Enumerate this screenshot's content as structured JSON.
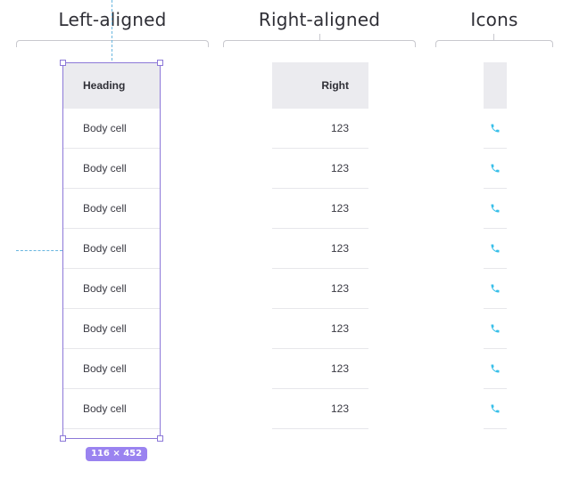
{
  "sections": {
    "left_title": "Left-aligned",
    "right_title": "Right-aligned",
    "icons_title": "Icons"
  },
  "left_table": {
    "heading": "Heading",
    "rows": [
      "Body cell",
      "Body cell",
      "Body cell",
      "Body cell",
      "Body cell",
      "Body cell",
      "Body cell",
      "Body cell"
    ]
  },
  "right_table": {
    "heading": "Right",
    "rows": [
      "123",
      "123",
      "123",
      "123",
      "123",
      "123",
      "123",
      "123"
    ]
  },
  "icons_table": {
    "heading": "",
    "icon_name": "phone-icon",
    "icon_color": "#38bfe9",
    "rows": [
      "phone-icon",
      "phone-icon",
      "phone-icon",
      "phone-icon",
      "phone-icon",
      "phone-icon",
      "phone-icon",
      "phone-icon"
    ]
  },
  "selection": {
    "badge": "116 × 452",
    "accent_color": "#8c78d8",
    "badge_color": "#9a83f0"
  },
  "guides": {
    "color": "#69b6df"
  }
}
